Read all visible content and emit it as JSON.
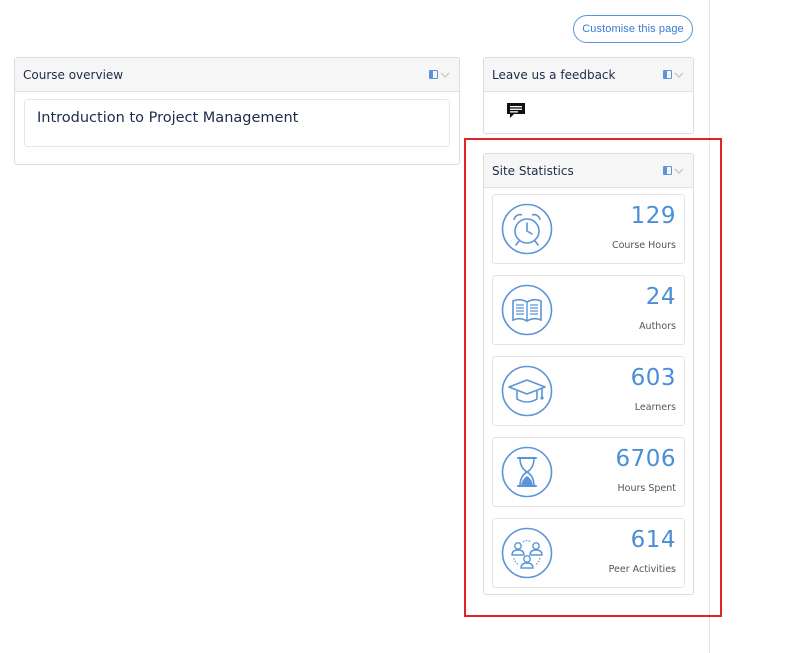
{
  "header": {
    "customise_button": "Customise this page"
  },
  "course_overview": {
    "title": "Course overview",
    "courses": [
      "Introduction to Project Management"
    ]
  },
  "feedback": {
    "title": "Leave us a feedback",
    "icon": "comment-icon"
  },
  "site_statistics": {
    "title": "Site Statistics",
    "stats": [
      {
        "value": "129",
        "label": "Course Hours",
        "icon": "alarm-clock-icon"
      },
      {
        "value": "24",
        "label": "Authors",
        "icon": "open-book-icon"
      },
      {
        "value": "603",
        "label": "Learners",
        "icon": "graduation-cap-icon"
      },
      {
        "value": "6706",
        "label": "Hours Spent",
        "icon": "hourglass-icon"
      },
      {
        "value": "614",
        "label": "Peer Activities",
        "icon": "peer-group-icon"
      }
    ]
  },
  "colors": {
    "accent": "#4a8fd6",
    "highlight": "#e02424"
  }
}
